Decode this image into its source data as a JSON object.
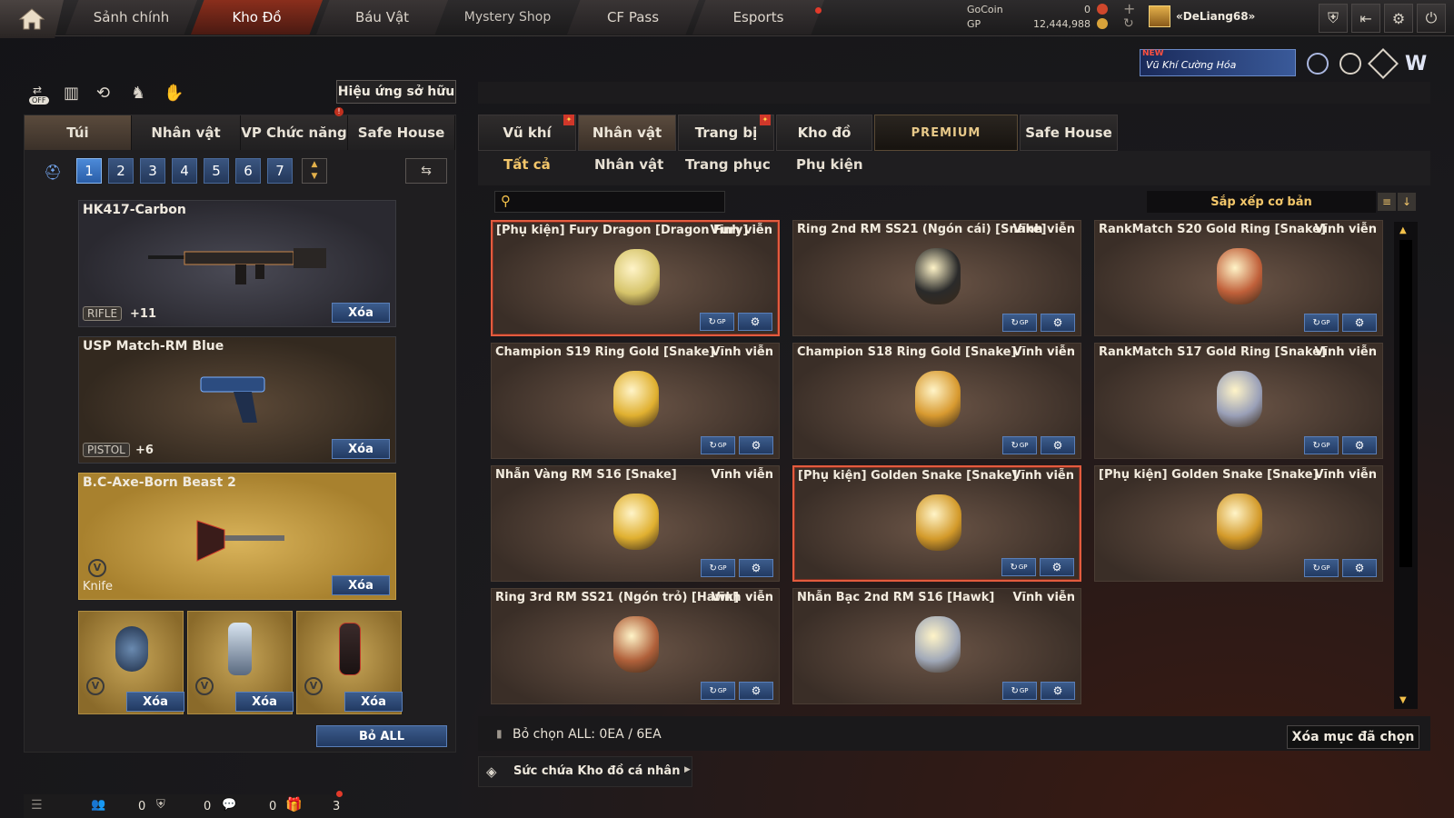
{
  "nav": {
    "tabs": [
      "Sảnh chính",
      "Kho Đồ",
      "Báu Vật",
      "Mystery Shop",
      "CF Pass",
      "Esports"
    ],
    "active": "Kho Đồ"
  },
  "currency": {
    "gocoin_label": "GoCoin",
    "gocoin_value": "0",
    "gp_label": "GP",
    "gp_value": "12,444,988"
  },
  "user": {
    "name": "«DeLiang68»"
  },
  "banner": {
    "badge": "NEW",
    "text": "Vũ Khí Cường Hóa"
  },
  "toolbar": {
    "off_label": "OFF",
    "effect_button": "Hiệu ứng sở hữu"
  },
  "left": {
    "tabs": [
      "Túi",
      "Nhân vật",
      "VP Chức năng",
      "Safe House"
    ],
    "pages": [
      "1",
      "2",
      "3",
      "4",
      "5",
      "6",
      "7"
    ],
    "slots": [
      {
        "name": "HK417-Carbon",
        "type": "RIFLE",
        "plus": "+11",
        "delete": "Xóa"
      },
      {
        "name": "USP Match-RM Blue",
        "type": "PISTOL",
        "plus": "+6",
        "delete": "Xóa"
      },
      {
        "name": "B.C-Axe-Born Beast 2",
        "type": "Knife",
        "delete": "Xóa"
      }
    ],
    "grenades": [
      {
        "delete": "Xóa"
      },
      {
        "delete": "Xóa"
      },
      {
        "delete": "Xóa"
      }
    ],
    "clear_all": "Bỏ ALL"
  },
  "right": {
    "tabs": [
      "Vũ khí",
      "Nhân vật",
      "Trang bị",
      "Kho đồ",
      "PREMIUM",
      "Safe House"
    ],
    "filters": [
      "Tất cả",
      "Nhân vật",
      "Trang phục",
      "Phụ kiện"
    ],
    "search_placeholder": "",
    "sort_label": "Sắp xếp cơ bản",
    "items": [
      {
        "name": "[Phụ kiện] Fury Dragon [Dragon Fury]",
        "duration": "Vĩnh viễn",
        "selected": true
      },
      {
        "name": "Ring 2nd RM SS21 (Ngón cái) [Snake]",
        "duration": "Vĩnh viễn",
        "selected": false
      },
      {
        "name": "RankMatch S20 Gold Ring [Snake]",
        "duration": "Vĩnh viễn",
        "selected": false
      },
      {
        "name": "Champion S19 Ring Gold [Snake]",
        "duration": "Vĩnh viễn",
        "selected": false
      },
      {
        "name": "Champion S18 Ring Gold [Snake]",
        "duration": "Vĩnh viễn",
        "selected": false
      },
      {
        "name": "RankMatch S17 Gold Ring [Snake]",
        "duration": "Vĩnh viễn",
        "selected": false
      },
      {
        "name": "Nhẫn Vàng RM S16 [Snake]",
        "duration": "Vĩnh viễn",
        "selected": false
      },
      {
        "name": "[Phụ kiện] Golden Snake [Snake]",
        "duration": "Vĩnh viễn",
        "selected": true
      },
      {
        "name": "[Phụ kiện] Golden Snake [Snake]",
        "duration": "Vĩnh viễn",
        "selected": false
      },
      {
        "name": "Ring 3rd RM SS21 (Ngón trỏ) [Hawk]",
        "duration": "Vĩnh viễn",
        "selected": false
      },
      {
        "name": "Nhẫn Bạc 2nd RM S16 [Hawk]",
        "duration": "Vĩnh viễn",
        "selected": false
      }
    ],
    "gp_tag": "GP",
    "deselect_all": "Bỏ chọn ALL: 0EA / 6EA",
    "delete_selected": "Xóa mục đã chọn",
    "capacity": "Sức chứa Kho đồ cá nhân"
  },
  "status": {
    "count1": "0",
    "count2": "0",
    "count3": "0",
    "gift_count": "3"
  },
  "colors": {
    "accent_red": "#e35b3e",
    "button_blue": "#2a5ea8",
    "gold": "#f3c66a"
  }
}
